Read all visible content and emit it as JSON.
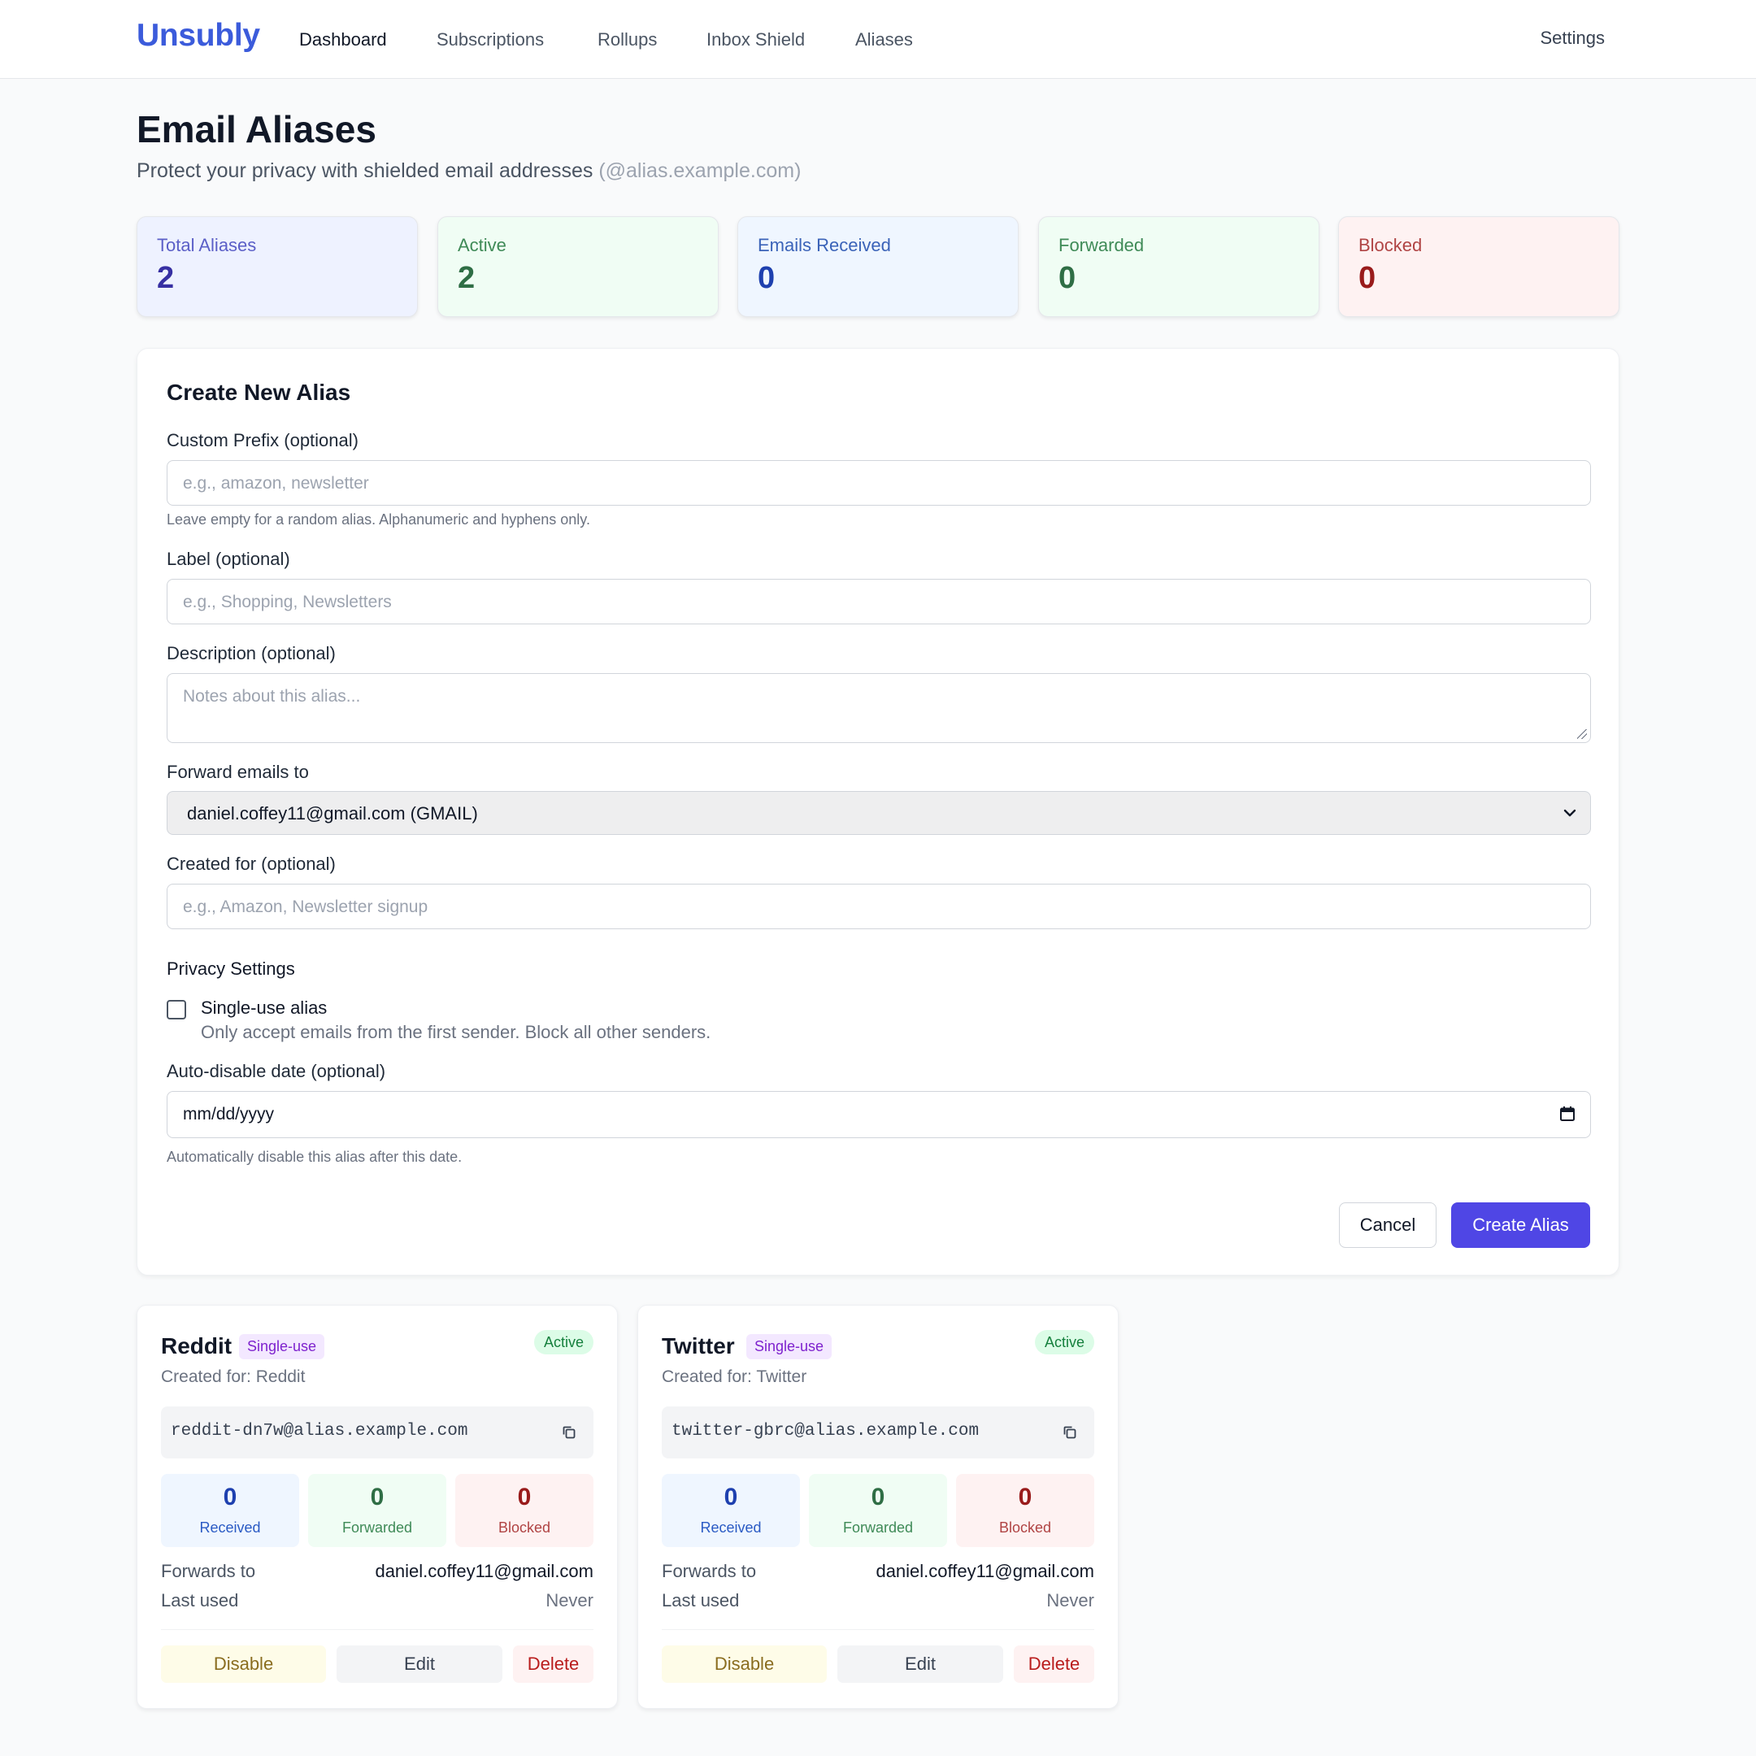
{
  "nav": {
    "brand": "Unsubly",
    "links": [
      "Dashboard",
      "Subscriptions",
      "Rollups",
      "Inbox Shield",
      "Aliases"
    ],
    "settings": "Settings"
  },
  "header": {
    "title": "Email Aliases",
    "subtitle": "Protect your privacy with shielded email addresses",
    "domain_hint": "(@alias.example.com)"
  },
  "stats": [
    {
      "label": "Total Aliases",
      "value": "2",
      "bg": "#eef2ff",
      "label_color": "#5b5fc7",
      "value_color": "#3730a3"
    },
    {
      "label": "Active",
      "value": "2",
      "bg": "#f0fdf4",
      "label_color": "#3f8a57",
      "value_color": "#2f6e45"
    },
    {
      "label": "Emails Received",
      "value": "0",
      "bg": "#eff6ff",
      "label_color": "#3b63b8",
      "value_color": "#1e40af"
    },
    {
      "label": "Forwarded",
      "value": "0",
      "bg": "#f0fdf4",
      "label_color": "#3f8a57",
      "value_color": "#2f6e45"
    },
    {
      "label": "Blocked",
      "value": "0",
      "bg": "#fef2f2",
      "label_color": "#b04444",
      "value_color": "#991b1b"
    }
  ],
  "form": {
    "title": "Create New Alias",
    "prefix_label": "Custom Prefix (optional)",
    "prefix_placeholder": "e.g., amazon, newsletter",
    "prefix_help": "Leave empty for a random alias. Alphanumeric and hyphens only.",
    "label_label": "Label (optional)",
    "label_placeholder": "e.g., Shopping, Newsletters",
    "description_label": "Description (optional)",
    "description_placeholder": "Notes about this alias...",
    "forward_label": "Forward emails to",
    "forward_value": "daniel.coffey11@gmail.com (GMAIL)",
    "created_for_label": "Created for (optional)",
    "created_for_placeholder": "e.g., Amazon, Newsletter signup",
    "privacy_title": "Privacy Settings",
    "single_use_label": "Single-use alias",
    "single_use_desc": "Only accept emails from the first sender. Block all other senders.",
    "single_use_checked": false,
    "autodisable_label": "Auto-disable date (optional)",
    "autodisable_value": "mm/dd/yyyy",
    "autodisable_help": "Automatically disable this alias after this date.",
    "cancel": "Cancel",
    "submit": "Create Alias"
  },
  "aliases": [
    {
      "name": "Reddit",
      "badge": "Single-use",
      "status": "Active",
      "created_for": "Created for: Reddit",
      "email": "reddit-dn7w@alias.example.com",
      "received": "0",
      "received_label": "Received",
      "forwarded": "0",
      "forwarded_label": "Forwarded",
      "blocked": "0",
      "blocked_label": "Blocked",
      "forwards_to_label": "Forwards to",
      "forwards_to": "daniel.coffey11@gmail.com",
      "last_used_label": "Last used",
      "last_used": "Never",
      "disable": "Disable",
      "edit": "Edit",
      "delete": "Delete"
    },
    {
      "name": "Twitter",
      "badge": "Single-use",
      "status": "Active",
      "created_for": "Created for: Twitter",
      "email": "twitter-gbrc@alias.example.com",
      "received": "0",
      "received_label": "Received",
      "forwarded": "0",
      "forwarded_label": "Forwarded",
      "blocked": "0",
      "blocked_label": "Blocked",
      "forwards_to_label": "Forwards to",
      "forwards_to": "daniel.coffey11@gmail.com",
      "last_used_label": "Last used",
      "last_used": "Never",
      "disable": "Disable",
      "edit": "Edit",
      "delete": "Delete"
    }
  ],
  "icons": {
    "copy": "copy-icon",
    "calendar": "calendar-icon",
    "select": "chevron-down-icon"
  }
}
